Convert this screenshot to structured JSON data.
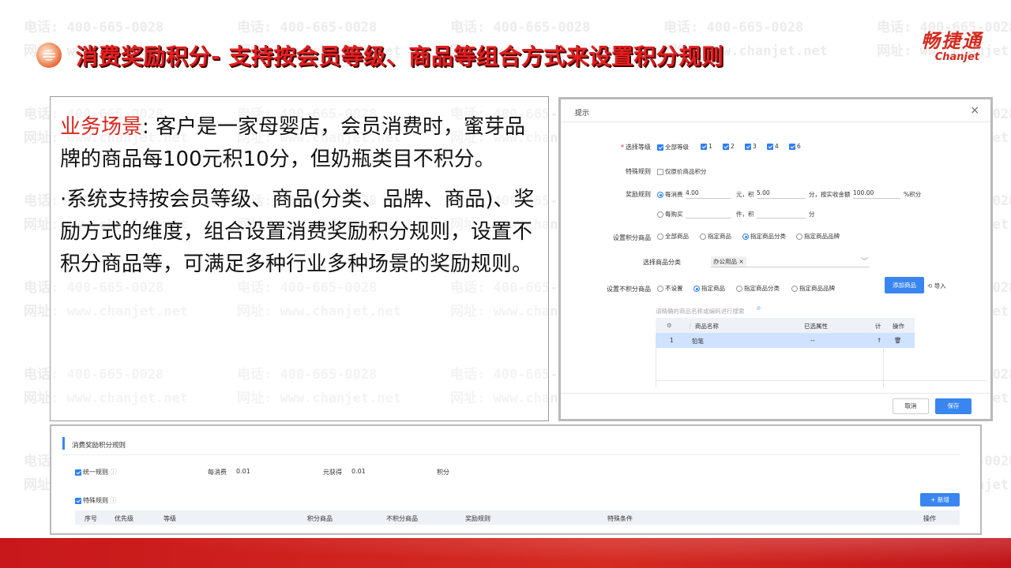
{
  "slide": {
    "title": "消费奖励积分- 支持按会员等级、商品等组合方式来设置积分规则",
    "brand_cn": "畅捷通",
    "brand_en": "Chanjet",
    "watermark_phone": "电话: 400-665-0028",
    "watermark_site": "网址: www.chanjet.net"
  },
  "textbox": {
    "label": "业务场景",
    "p1_rest": ": 客户是一家母婴店，会员消费时，蜜芽品牌的商品每100元积10分，但奶瓶类目不积分。",
    "p2": "·系统支持按会员等级、商品(分类、品牌、商品)、奖励方式的维度，组合设置消费奖励积分规则，设置不积分商品等，可满足多种行业多种场景的奖励规则。"
  },
  "dialog": {
    "title": "提示",
    "close": "×",
    "levels": {
      "label": "选择等级",
      "all": "全部等级",
      "items": [
        "1",
        "2",
        "3",
        "4",
        "6"
      ]
    },
    "special": {
      "label": "特殊规则",
      "option": "仅原价商品积分"
    },
    "reward": {
      "label": "奖励规则",
      "opt1": "每消费",
      "opt1_value": "4.00",
      "yuan_ji": "元，积",
      "points_value": "5.00",
      "fen_actual": "分，按实收金额",
      "actual_value": "100.00",
      "percent": "%积分",
      "opt2": "每购买",
      "jian_ji": "件，积",
      "fen": "分"
    },
    "points_goods": {
      "label": "设置积分商品",
      "options": [
        "全部商品",
        "指定商品",
        "指定商品分类",
        "指定商品品牌"
      ]
    },
    "category": {
      "label": "选择商品分类",
      "tag": "办公用品 ×"
    },
    "no_points": {
      "label": "设置不积分商品",
      "options": [
        "不设置",
        "指定商品",
        "指定商品分类",
        "指定商品品牌"
      ],
      "add_button": "添加商品",
      "import": "导入"
    },
    "search_placeholder": "请精确的商品名称或编码进行搜索",
    "table": {
      "headers": [
        "",
        "商品名称",
        "已选属性",
        "计",
        "操作"
      ],
      "row": {
        "index": "1",
        "name": "铅笔",
        "attr": "--"
      }
    },
    "cancel": "取消",
    "save": "保存"
  },
  "bottom": {
    "title": "消费奖励积分规则",
    "unified": "统一规则",
    "each_spend": "每消费",
    "each_spend_value": "0.01",
    "yuan_get": "元获得",
    "yuan_get_value": "0.01",
    "points": "积分",
    "special": "特殊规则",
    "add": "+ 新增",
    "headers": [
      "序号",
      "优先级",
      "等级",
      "积分商品",
      "不积分商品",
      "奖励规则",
      "特殊条件",
      "操作"
    ]
  }
}
